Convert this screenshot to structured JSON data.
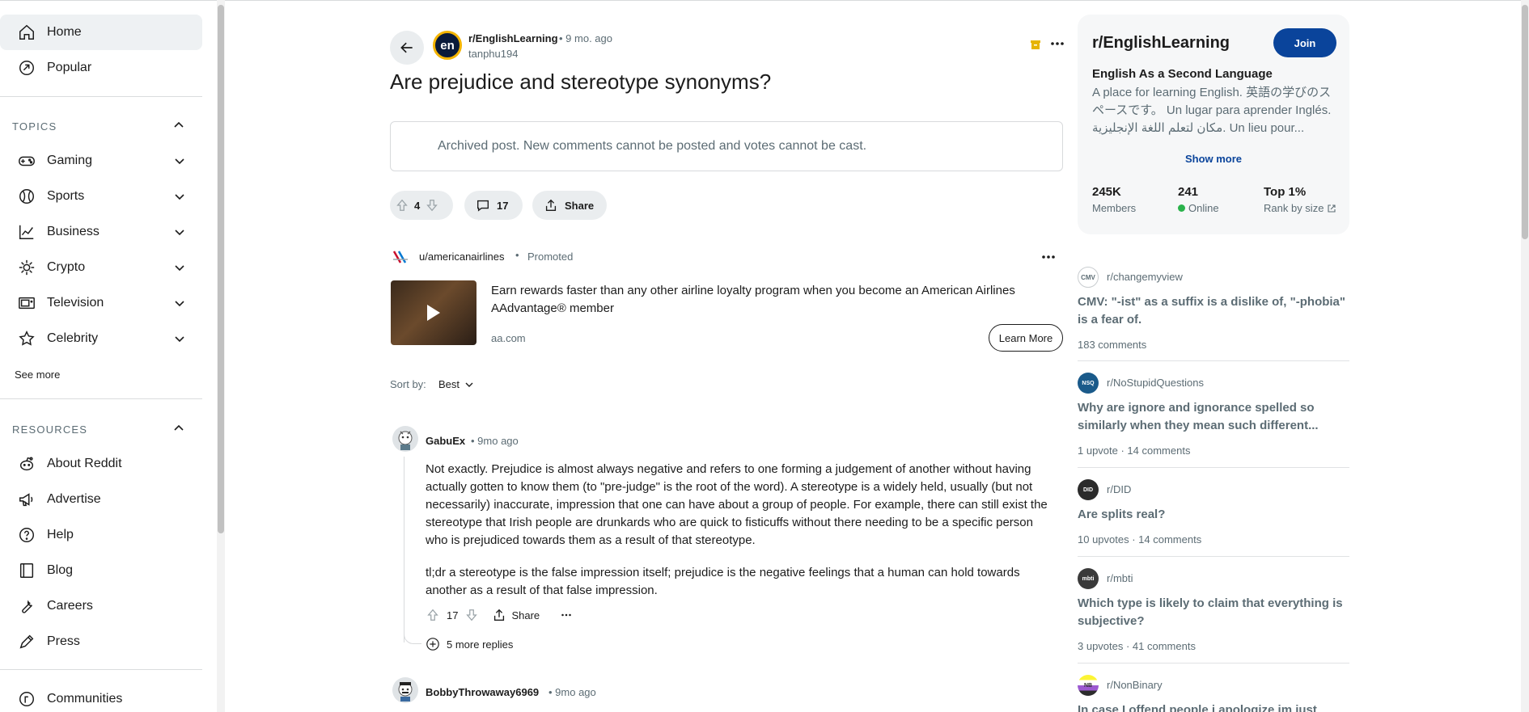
{
  "sidebar": {
    "home": "Home",
    "popular": "Popular",
    "topics_header": "TOPICS",
    "topics": [
      {
        "label": "Gaming"
      },
      {
        "label": "Sports"
      },
      {
        "label": "Business"
      },
      {
        "label": "Crypto"
      },
      {
        "label": "Television"
      },
      {
        "label": "Celebrity"
      }
    ],
    "see_more": "See more",
    "resources_header": "RESOURCES",
    "resources": [
      {
        "label": "About Reddit"
      },
      {
        "label": "Advertise"
      },
      {
        "label": "Help"
      },
      {
        "label": "Blog"
      },
      {
        "label": "Careers"
      },
      {
        "label": "Press"
      }
    ],
    "communities": "Communities"
  },
  "post": {
    "subreddit": "r/EnglishLearning",
    "age": "• 9 mo. ago",
    "author": "tanphu194",
    "avatar_text": "en",
    "title": "Are prejudice and stereotype synonyms?",
    "archived_notice": "Archived post. New comments cannot be posted and votes cannot be cast.",
    "votes": "4",
    "comments": "17",
    "share": "Share"
  },
  "promo": {
    "user": "u/americanairlines",
    "dot": "•",
    "label": "Promoted",
    "text": "Earn rewards faster than any other airline loyalty program when you become an American Airlines AAdvantage® member",
    "domain": "aa.com",
    "cta": "Learn More"
  },
  "sort": {
    "label": "Sort by:",
    "value": "Best"
  },
  "comments": [
    {
      "user": "GabuEx",
      "age": "• 9mo ago",
      "paragraphs": [
        "Not exactly. Prejudice is almost always negative and refers to one forming a judgement of another without having actually gotten to know them (to \"pre-judge\" is the root of the word). A stereotype is a widely held, usually (but not necessarily) inaccurate, impression that one can have about a group of people. For example, there can still exist the stereotype that Irish people are drunkards who are quick to fisticuffs without there needing to be a specific person who is prejudiced towards them as a result of that stereotype.",
        "tl;dr a stereotype is the false impression itself; prejudice is the negative feelings that a human can hold towards another as a result of that false impression."
      ],
      "votes": "17",
      "share": "Share",
      "more_replies": "5 more replies"
    },
    {
      "user": "BobbyThrowaway6969",
      "age": "• 9mo ago"
    }
  ],
  "about": {
    "name": "r/EnglishLearning",
    "join": "Join",
    "title": "English As a Second Language",
    "description": "A place for learning English. 英語の学びのスペースです。 Un lugar para aprender Inglés. مكان لتعلم اللغة الإنجليزية. Un lieu pour...",
    "show_more": "Show more",
    "members_value": "245K",
    "members_label": "Members",
    "online_value": "241",
    "online_label": "Online",
    "rank_value": "Top 1%",
    "rank_label": "Rank by size"
  },
  "related": [
    {
      "subreddit": "r/changemyview",
      "avatar": "CMV",
      "title": "CMV: \"-ist\" as a suffix is a dislike of, \"-phobia\" is a fear of.",
      "meta": "183 comments"
    },
    {
      "subreddit": "r/NoStupidQuestions",
      "avatar": "NSQ",
      "title": "Why are ignore and ignorance spelled so similarly when they mean such different...",
      "meta": "1 upvote · 14 comments"
    },
    {
      "subreddit": "r/DID",
      "avatar": "DID",
      "title": "Are splits real?",
      "meta": "10 upvotes · 14 comments"
    },
    {
      "subreddit": "r/mbti",
      "avatar": "mbti",
      "title": "Which type is likely to claim that everything is subjective?",
      "meta": "3 upvotes · 41 comments"
    },
    {
      "subreddit": "r/NonBinary",
      "avatar": "NB",
      "title": "In case I offend people i apologize im just here...",
      "meta": ""
    }
  ],
  "colors": {
    "accent": "#0a449b",
    "online": "#2ab24b",
    "muted": "#5c6c74"
  }
}
